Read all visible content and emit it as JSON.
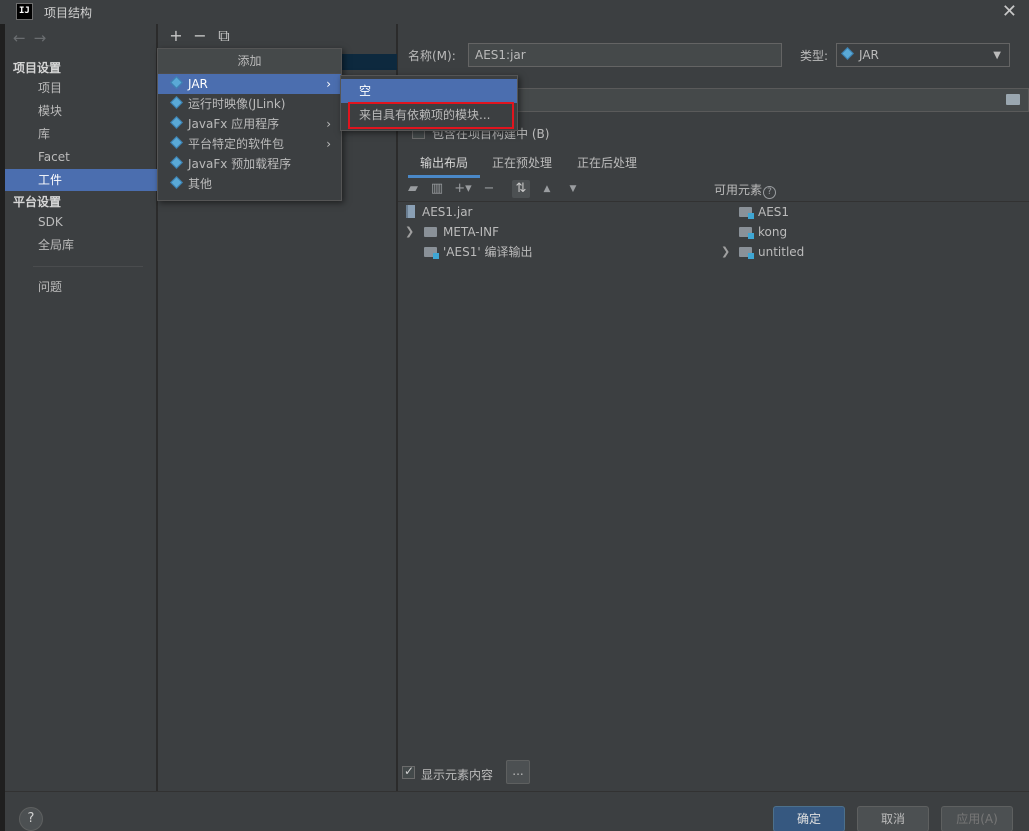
{
  "window": {
    "app_icon": "IJ",
    "title": "项目结构",
    "close_label": "✕"
  },
  "nav_arrows": {
    "back": "←",
    "forward": "→"
  },
  "sidebar": {
    "project_settings_heading": "项目设置",
    "project_settings": [
      {
        "label": "项目"
      },
      {
        "label": "模块"
      },
      {
        "label": "库"
      },
      {
        "label": "Facet"
      },
      {
        "label": "工件",
        "selected": true
      }
    ],
    "platform_settings_heading": "平台设置",
    "platform_settings": [
      {
        "label": "SDK"
      },
      {
        "label": "全局库"
      }
    ],
    "problems_label": "问题"
  },
  "middle_toolbar": {
    "add": "+",
    "remove": "−",
    "copy": "⧉"
  },
  "add_menu": {
    "header": "添加",
    "items": [
      {
        "label": "JAR",
        "icon": "diamond-icon",
        "submenu": true,
        "selected": true
      },
      {
        "label": "运行时映像(JLink)",
        "icon": "diamond-icon",
        "submenu": false
      },
      {
        "label": "JavaFx 应用程序",
        "icon": "diamond-icon",
        "submenu": true
      },
      {
        "label": "平台特定的软件包",
        "icon": "diamond-icon",
        "submenu": true
      },
      {
        "label": "JavaFx 预加载程序",
        "icon": "diamond-icon",
        "submenu": false
      },
      {
        "label": "其他",
        "icon": "diamond-icon",
        "submenu": false
      }
    ],
    "submenu_arrow": "›"
  },
  "jar_submenu": {
    "items": [
      {
        "label": "空",
        "selected": true
      },
      {
        "label": "来自具有依赖项的模块...",
        "selected": false,
        "highlighted_box": true
      }
    ]
  },
  "artifact": {
    "name_label": "名称(M):",
    "name_value": "AES1:jar",
    "type_label": "类型:",
    "type_value": "JAR",
    "include_in_build_label": "包含在项目构建中 (B)",
    "include_in_build_checked": false
  },
  "tabs": [
    {
      "label": "输出布局",
      "selected": true
    },
    {
      "label": "正在预处理",
      "selected": false
    },
    {
      "label": "正在后处理",
      "selected": false
    }
  ],
  "output_tree": [
    {
      "label": "AES1.jar",
      "icon": "jar-icon",
      "expandable": false
    },
    {
      "label": "META-INF",
      "icon": "folder-icon",
      "expandable": true
    },
    {
      "label": "'AES1' 编译输出",
      "icon": "module-folder-icon",
      "expandable": false
    }
  ],
  "available_elements": {
    "heading": "可用元素",
    "help": "?",
    "items": [
      {
        "label": "AES1",
        "expandable": false
      },
      {
        "label": "kong",
        "expandable": false
      },
      {
        "label": "untitled",
        "expandable": true
      }
    ]
  },
  "show_content": {
    "label": "显示元素内容",
    "checked": true,
    "more_button": "..."
  },
  "footer": {
    "help": "?",
    "ok": "确定",
    "cancel": "取消",
    "apply": "应用(A)"
  },
  "colors": {
    "selection": "#4b6eaf",
    "highlight_box": "#e0141e",
    "primary_button": "#365880"
  }
}
